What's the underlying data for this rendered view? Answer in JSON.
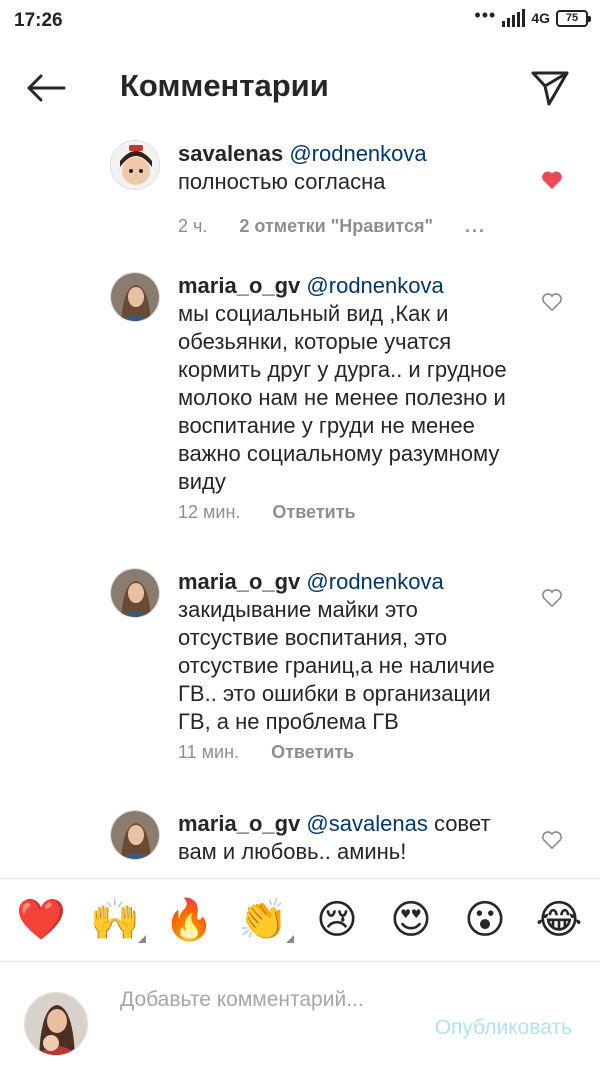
{
  "status_bar": {
    "time": "17:26",
    "dots": "•••",
    "network": "4G",
    "battery": "75"
  },
  "header": {
    "title": "Комментарии"
  },
  "comments": [
    {
      "username": "savalenas",
      "mention": "@rodnenkova",
      "text": "полностью согласна",
      "time": "2 ч.",
      "action": "2 отметки \"Нравится\"",
      "more": "...",
      "liked": true
    },
    {
      "username": "maria_o_gv",
      "mention": "@rodnenkova",
      "text": "мы социальный вид ,Как и обезьянки, которые учатся кормить друг у дурга.. и грудное молоко нам не менее полезно и воспитание у груди не менее важно социальному разумному виду",
      "time": "12 мин.",
      "action": "Ответить",
      "liked": false
    },
    {
      "username": "maria_o_gv",
      "mention": "@rodnenkova",
      "text": "закидывание майки это отсуствие воспитания, это отсуствие границ,а не наличие ГВ.. это ошибки в организации ГВ, а не проблема ГВ",
      "time": "11 мин.",
      "action": "Ответить",
      "liked": false
    },
    {
      "username": "maria_o_gv",
      "mention": "@savalenas",
      "text": "совет вам и любовь.. аминь!",
      "liked": false
    }
  ],
  "emoji_bar": [
    {
      "name": "red-heart",
      "glyph": "❤️"
    },
    {
      "name": "raising-hands",
      "glyph": "🙌"
    },
    {
      "name": "fire",
      "glyph": "🔥"
    },
    {
      "name": "clapping-hands",
      "glyph": "👏"
    },
    {
      "name": "crying-face",
      "glyph": "😢"
    },
    {
      "name": "heart-eyes",
      "glyph": "😍"
    },
    {
      "name": "open-mouth-face",
      "glyph": "😮"
    },
    {
      "name": "tears-of-joy",
      "glyph": "😂"
    }
  ],
  "input": {
    "placeholder": "Добавьте комментарий...",
    "publish": "Опубликовать"
  },
  "colors": {
    "text": "#262626",
    "secondary": "#8e8e8e",
    "mention": "#00376b",
    "like_red": "#ed4956",
    "publish_disabled": "#b2dffc"
  }
}
